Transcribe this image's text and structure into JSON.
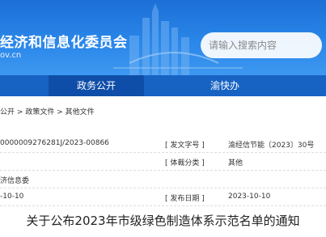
{
  "header": {
    "site_title": "经济和信息化委员会",
    "site_domain": "ov.cn",
    "search_placeholder": "请输入搜索内容"
  },
  "nav": {
    "items": [
      "政务公开",
      "渝快办"
    ]
  },
  "breadcrumb": {
    "items": [
      "公开",
      "政策文件",
      "其他文件"
    ],
    "separator": ">"
  },
  "info": {
    "rows": [
      {
        "left_value": "0000009276281J/2023-00866",
        "right_label": "[ 发文字号 ]",
        "right_value": "渝经信节能〔2023〕30号"
      },
      {
        "left_value": "",
        "right_label": "[ 体裁分类 ]",
        "right_value": "其他"
      },
      {
        "left_value": "济信息委",
        "right_label": "",
        "right_value": ""
      },
      {
        "left_value": "-10-10",
        "right_label": "[ 发布日期 ]",
        "right_value": "2023-10-10"
      }
    ]
  },
  "document": {
    "title": "关于公布2023年市级绿色制造体系示范名单的通知"
  }
}
